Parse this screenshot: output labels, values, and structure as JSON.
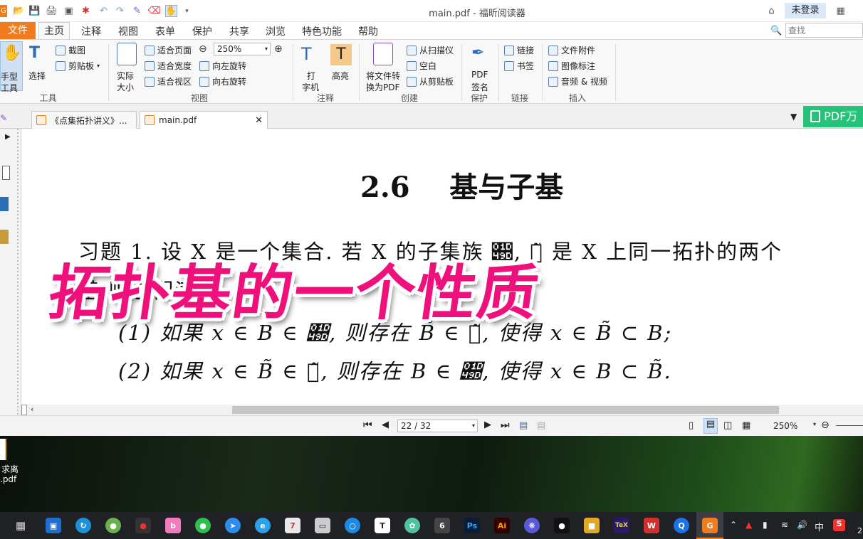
{
  "app": {
    "window_title": "main.pdf - 福昕阅读器"
  },
  "account": {
    "login_label": "未登录"
  },
  "search": {
    "placeholder": "查找"
  },
  "menu": [
    "文件",
    "主页",
    "注释",
    "视图",
    "表单",
    "保护",
    "共享",
    "浏览",
    "特色功能",
    "帮助"
  ],
  "ribbon": {
    "tools": {
      "hand_line1": "手型",
      "hand_line2": "工具",
      "select": "选择",
      "screenshot": "截图",
      "clipboard": "剪贴板",
      "group": "工具"
    },
    "view": {
      "actual_size_line1": "实际",
      "actual_size_line2": "大小",
      "fit_page": "适合页面",
      "fit_width": "适合宽度",
      "fit_visible": "适合视区",
      "zoom_value": "250%",
      "rotate_left": "向左旋转",
      "rotate_right": "向右旋转",
      "group": "视图"
    },
    "comment": {
      "typewriter_line1": "打",
      "typewriter_line2": "字机",
      "highlight": "高亮",
      "group": "注释"
    },
    "create": {
      "convert_line1": "将文件转",
      "convert_line2": "换为PDF",
      "from_scanner": "从扫描仪",
      "blank": "空白",
      "from_clipboard": "从剪贴板",
      "group": "创建"
    },
    "protect": {
      "sign_line1": "PDF",
      "sign_line2": "签名",
      "group": "保护"
    },
    "links": {
      "link": "链接",
      "bookmark": "书签",
      "group": "链接"
    },
    "insert": {
      "attachment": "文件附件",
      "image_annotation": "图像标注",
      "audio_video": "音频 & 视频",
      "group": "插入"
    }
  },
  "tabs": [
    {
      "label": "《点集拓扑讲义》..."
    },
    {
      "label": "main.pdf"
    }
  ],
  "promo": {
    "label": "PDF万"
  },
  "document": {
    "heading": "2.6    基与子基",
    "exercise_line1": "习题 1. 设 X 是一个集合. 若 X 的子集族 𝒝, 𝒝̃ 是 X 上同一拓扑的两个",
    "exercise_line2": "基,则它们满足:",
    "item1": "(1) 如果 x ∈ B ∈ 𝒝, 则存在 B̃ ∈ 𝒝̃, 使得 x ∈ B̃ ⊂ B;",
    "item2": "(2) 如果 x ∈ B̃ ∈ 𝒝̃, 则存在 B ∈ 𝒝, 使得 x ∈ B ⊂ B̃."
  },
  "overlay_caption": "拓扑基的一个性质",
  "status": {
    "page_indicator": "22 / 32",
    "zoom": "250%"
  },
  "desktop": {
    "file_line1": "求离",
    "file_line2": ".pdf"
  },
  "taskbar": {
    "ime": "中",
    "clock_partial": "2"
  },
  "colors": {
    "accent_orange": "#f07c1e",
    "overlay_pink": "#f0107c",
    "promo_green": "#27c27a"
  }
}
